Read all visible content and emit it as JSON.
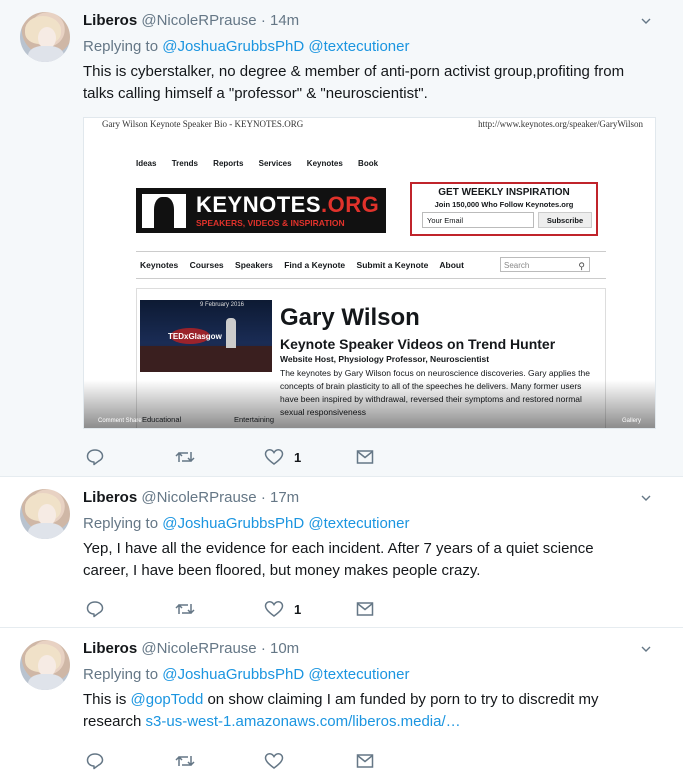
{
  "colors": {
    "link": "#1b95e0",
    "secondary": "#657786",
    "divider": "#e6ecf0",
    "highlight_bg": "#f5f8fa"
  },
  "tweets": [
    {
      "name": "Liberos",
      "handle": "@NicoleRPrause",
      "sep": "·",
      "time": "14m",
      "replying_label": "Replying to",
      "mentions": [
        "@JoshuaGrubbsPhD",
        "@textecutioner"
      ],
      "text": "This is cyberstalker, no degree & member of anti-porn activist group,profiting from talks calling himself a \"professor\" & \"neuroscientist\".",
      "likes": "1",
      "media": {
        "pdf_title": "Gary Wilson Keynote Speaker Bio - KEYNOTES.ORG",
        "pdf_url": "http://www.keynotes.org/speaker/GaryWilson",
        "top_nav": [
          "Ideas",
          "Trends",
          "Reports",
          "Services",
          "Keynotes",
          "Book"
        ],
        "logo_main": "KEYNOTES",
        "logo_org": ".ORG",
        "logo_tagline": "SPEAKERS, VIDEOS & INSPIRATION",
        "promo_heading": "GET WEEKLY INSPIRATION",
        "promo_sub": "Join 150,000 Who Follow Keynotes.org",
        "promo_email_placeholder": "Your Email",
        "promo_button": "Subscribe",
        "main_nav": [
          "Keynotes",
          "Courses",
          "Speakers",
          "Find a Keynote",
          "Submit a Keynote",
          "About"
        ],
        "search_placeholder": "Search",
        "video_date": "9 February 2016",
        "video_brand": "TEDxGlasgow",
        "speaker_name": "Gary Wilson",
        "speaker_subtitle": "Keynote Speaker Videos on Trend Hunter",
        "speaker_role": "Website Host, Physiology Professor, Neuroscientist",
        "speaker_desc": "The keynotes by Gary Wilson focus on neuroscience discoveries. Gary applies the concepts of brain plasticity to all of the speeches he delivers. Many former users have been inspired by withdrawal, reversed their symptoms and restored normal sexual responsiveness",
        "tag_left": "Educational",
        "tag_right": "Entertaining",
        "foot_left": "Comment   Share",
        "foot_right": "Gallery"
      }
    },
    {
      "name": "Liberos",
      "handle": "@NicoleRPrause",
      "sep": "·",
      "time": "17m",
      "replying_label": "Replying to",
      "mentions": [
        "@JoshuaGrubbsPhD",
        "@textecutioner"
      ],
      "text": "Yep, I have all the evidence for each incident. After 7 years of a quiet science career, I have been floored, but money makes people crazy.",
      "likes": "1"
    },
    {
      "name": "Liberos",
      "handle": "@NicoleRPrause",
      "sep": "·",
      "time": "10m",
      "replying_label": "Replying to",
      "mentions": [
        "@JoshuaGrubbsPhD",
        "@textecutioner"
      ],
      "text_pre": "This is ",
      "text_mention": "@gopTodd",
      "text_mid": " on show claiming I am funded by porn to try to discredit my research ",
      "text_link": "s3-us-west-1.amazonaws.com/liberos.media/…",
      "likes": ""
    }
  ]
}
